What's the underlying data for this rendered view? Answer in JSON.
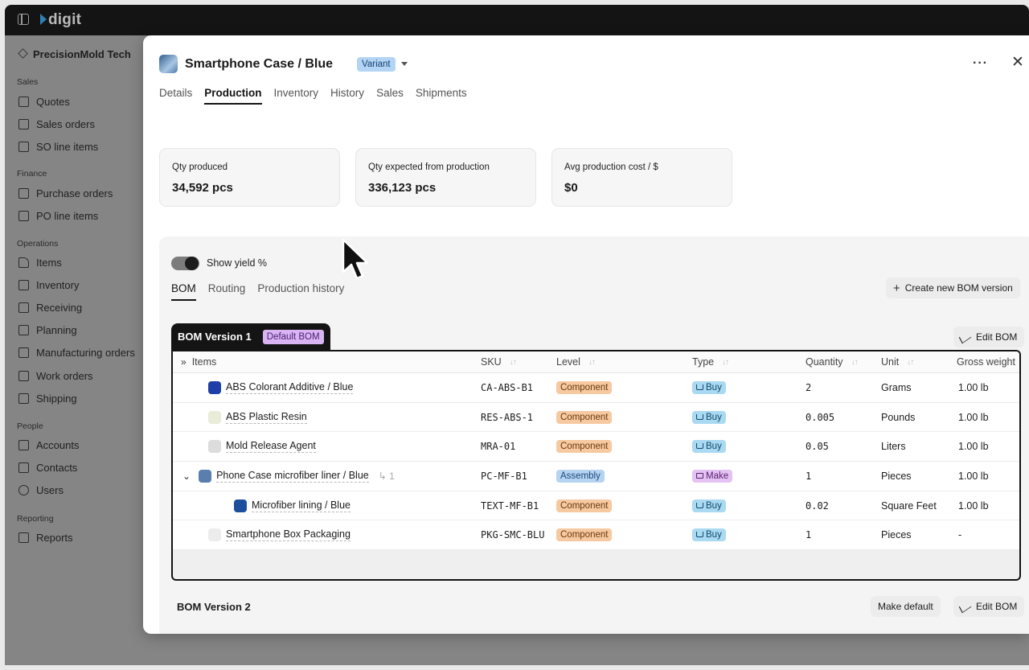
{
  "app": {
    "logo": "digit"
  },
  "sidebar": {
    "org": "PrecisionMold Tech",
    "sections": [
      {
        "title": "Sales",
        "items": [
          "Quotes",
          "Sales orders",
          "SO line items"
        ]
      },
      {
        "title": "Finance",
        "items": [
          "Purchase orders",
          "PO line items"
        ]
      },
      {
        "title": "Operations",
        "items": [
          "Items",
          "Inventory",
          "Receiving",
          "Planning",
          "Manufacturing orders",
          "Work orders",
          "Shipping"
        ]
      },
      {
        "title": "People",
        "items": [
          "Accounts",
          "Contacts",
          "Users"
        ]
      },
      {
        "title": "Reporting",
        "items": [
          "Reports"
        ]
      }
    ]
  },
  "modal": {
    "title": "Smartphone Case / Blue",
    "badge": "Variant",
    "more_label": "···",
    "close_label": "✕",
    "tabs": [
      "Details",
      "Production",
      "Inventory",
      "History",
      "Sales",
      "Shipments"
    ],
    "active_tab": "Production",
    "stats": [
      {
        "label": "Qty produced",
        "value": "34,592 pcs"
      },
      {
        "label": "Qty expected from production",
        "value": "336,123 pcs"
      },
      {
        "label": "Avg production cost / $",
        "value": "$0"
      }
    ],
    "toggle_label": "Show yield %",
    "subtabs": [
      "BOM",
      "Routing",
      "Production history"
    ],
    "create_bom_label": "Create new BOM version",
    "bom1": {
      "name": "BOM Version 1",
      "default_badge": "Default BOM",
      "edit_label": "Edit BOM",
      "columns": [
        "Items",
        "SKU",
        "Level",
        "Type",
        "Quantity",
        "Unit",
        "Gross weight"
      ],
      "rows": [
        {
          "item": "ABS Colorant Additive / Blue",
          "sku": "CA-ABS-B1",
          "level": "Component",
          "type": "Buy",
          "qty": "2",
          "unit": "Grams",
          "weight": "1.00 lb",
          "thumb_color": "#1f3fa8",
          "indent": 0
        },
        {
          "item": "ABS Plastic Resin",
          "sku": "RES-ABS-1",
          "level": "Component",
          "type": "Buy",
          "qty": "0.005",
          "unit": "Pounds",
          "weight": "1.00 lb",
          "thumb_color": "#e8ecd8",
          "indent": 0
        },
        {
          "item": "Mold Release Agent",
          "sku": "MRA-01",
          "level": "Component",
          "type": "Buy",
          "qty": "0.05",
          "unit": "Liters",
          "weight": "1.00 lb",
          "thumb_color": "#dcdcdc",
          "indent": 0
        },
        {
          "item": "Phone Case microfiber liner / Blue",
          "sku": "PC-MF-B1",
          "level": "Assembly",
          "type": "Make",
          "qty": "1",
          "unit": "Pieces",
          "weight": "1.00 lb",
          "thumb_color": "#5a7fae",
          "indent": 0,
          "expanded": true,
          "sub_count": "1"
        },
        {
          "item": "Microfiber lining / Blue",
          "sku": "TEXT-MF-B1",
          "level": "Component",
          "type": "Buy",
          "qty": "0.02",
          "unit": "Square Feet",
          "weight": "1.00 lb",
          "thumb_color": "#1e4f9c",
          "indent": 1
        },
        {
          "item": "Smartphone Box Packaging",
          "sku": "PKG-SMC-BLU",
          "level": "Component",
          "type": "Buy",
          "qty": "1",
          "unit": "Pieces",
          "weight": "-",
          "thumb_color": "#ececec",
          "indent": 0
        }
      ]
    },
    "bom2": {
      "name": "BOM Version 2",
      "make_default_label": "Make default",
      "edit_label": "Edit BOM"
    }
  }
}
